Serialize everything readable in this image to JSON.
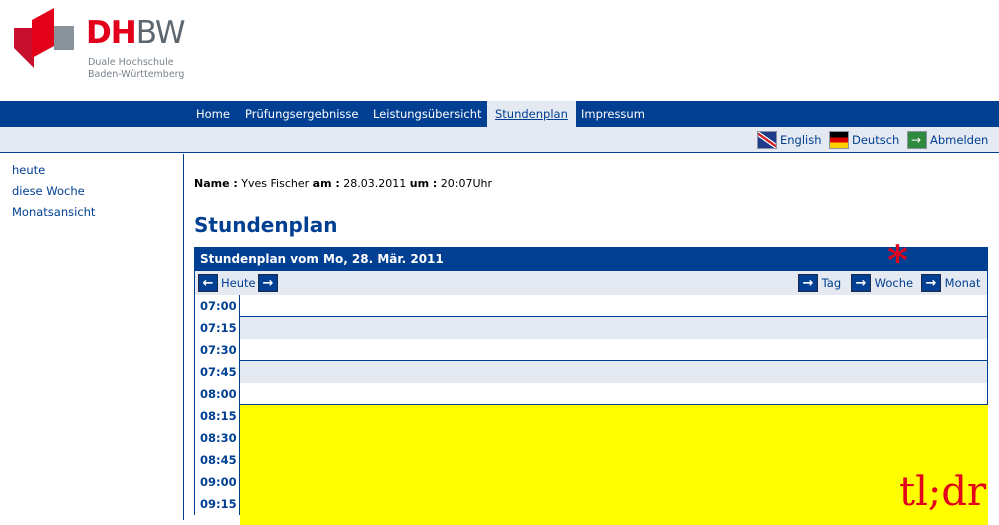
{
  "logo": {
    "dh": "DH",
    "bw": "BW",
    "subline1": "Duale Hochschule",
    "subline2": "Baden-Württemberg"
  },
  "nav": {
    "items": [
      "Home",
      "Prüfungsergebnisse",
      "Leistungsübersicht",
      "Stundenplan",
      "Impressum"
    ],
    "active": "Stundenplan"
  },
  "lang": {
    "english": "English",
    "deutsch": "Deutsch",
    "logout": "Abmelden"
  },
  "sidebar": {
    "items": [
      "heute",
      "diese Woche",
      "Monatsansicht"
    ]
  },
  "user": {
    "name_label": "Name :",
    "name": "Yves Fischer",
    "date_label": "am :",
    "date": "28.03.2011",
    "time_label": "um :",
    "time": "20:07Uhr"
  },
  "page_title": "Stundenplan",
  "calendar": {
    "header": "Stundenplan vom Mo, 28. Mär. 2011",
    "today_label": "Heute",
    "day_label": "Tag",
    "week_label": "Woche",
    "month_label": "Monat",
    "slots": [
      "07:00",
      "07:15",
      "07:30",
      "07:45",
      "08:00",
      "08:15",
      "08:30",
      "08:45",
      "09:00",
      "09:15"
    ],
    "busy_from": "08:15"
  },
  "annotations": {
    "asterisk": "*",
    "tldr": "tl;dr"
  },
  "colors": {
    "brand_blue": "#003f91",
    "brand_red": "#e2001a",
    "busy_yellow": "#ffff00",
    "light_band": "#e4e9f2"
  }
}
